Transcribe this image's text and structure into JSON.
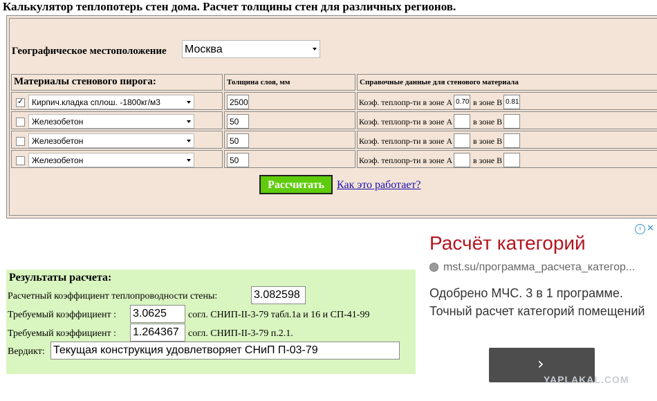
{
  "page": {
    "title": "Калькулятор теплопотерь стен дома. Расчет толщины стен для различных регионов."
  },
  "location": {
    "label": "Географическое местоположение",
    "selected": "Москва"
  },
  "table": {
    "headers": {
      "materials": "Материалы стенового пирога:",
      "thickness": "Толщина слоя, мм",
      "reference": "Справочные данные для стенового материала"
    },
    "zone_a_label": "Коэф. теплопр-ти в зоне А",
    "zone_b_label": "в зоне В",
    "rows": [
      {
        "checked": true,
        "material": "Кирпич.кладка сплош. -1800кг/м3",
        "thickness": "2500",
        "zone_a": "0.70",
        "zone_b": "0.81"
      },
      {
        "checked": false,
        "material": "Железобетон",
        "thickness": "50",
        "zone_a": "",
        "zone_b": ""
      },
      {
        "checked": false,
        "material": "Железобетон",
        "thickness": "50",
        "zone_a": "",
        "zone_b": ""
      },
      {
        "checked": false,
        "material": "Железобетон",
        "thickness": "50",
        "zone_a": "",
        "zone_b": ""
      }
    ]
  },
  "actions": {
    "calculate": "Рассчитать",
    "how_it_works": "Как это работает?"
  },
  "results": {
    "title": "Результаты расчета:",
    "calc_coef_label": "Расчетный коэффициент теплопроводности стены:",
    "calc_coef_value": "3.082598",
    "req_coef_label": "Требуемый коэффициент :",
    "req1_value": "3.0625",
    "req1_note": "согл. СНИП-II-3-79 табл.1а и 16 и СП-41-99",
    "req2_value": "1.264367",
    "req2_note": "согл. СНИП-II-3-79 п.2.1.",
    "verdict_label": "Вердикт:",
    "verdict_value": "Текущая конструкция удовлетворяет СНиП П-03-79"
  },
  "ad": {
    "title": "Расчёт категорий",
    "url": "mst.su/программа_расчета_категор...",
    "description": "Одобрено МЧС. 3 в 1 программе. Точный расчет категорий помещений",
    "arrow": "›",
    "info": "i",
    "close": "✕"
  },
  "watermark": "YAPLAKAL.COM",
  "colors": {
    "panel_bg": "#f3e4d7",
    "results_bg": "#d9f5c0",
    "button_bg": "#5fcc0b",
    "ad_title": "#b3141e",
    "link": "#1a0dab"
  }
}
